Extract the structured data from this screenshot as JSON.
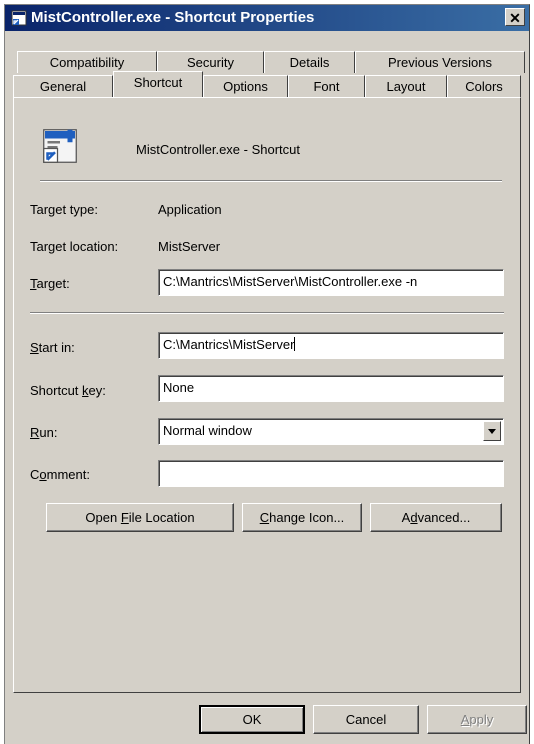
{
  "window": {
    "title": "MistController.exe - Shortcut Properties",
    "close_glyph": "✕"
  },
  "tabs_row_back": [
    "Compatibility",
    "Security",
    "Details",
    "Previous Versions"
  ],
  "tabs_row_front": [
    "General",
    "Shortcut",
    "Options",
    "Font",
    "Layout",
    "Colors"
  ],
  "selected_tab": "Shortcut",
  "shortcut": {
    "name": "MistController.exe - Shortcut",
    "icon": "shortcut-app-icon",
    "target_type_label": "Target type:",
    "target_type_value": "Application",
    "target_location_label": "Target location:",
    "target_location_value": "MistServer",
    "target_label_u": "T",
    "target_label_rest": "arget:",
    "target_value": "C:\\Mantrics\\MistServer\\MistController.exe -n",
    "start_in_label_u": "S",
    "start_in_label_rest": "tart in:",
    "start_in_value": "C:\\Mantrics\\MistServer",
    "shortcut_key_label_pre": "Shortcut ",
    "shortcut_key_label_u": "k",
    "shortcut_key_label_rest": "ey:",
    "shortcut_key_value": "None",
    "run_label_u": "R",
    "run_label_rest": "un:",
    "run_value": "Normal window",
    "comment_label_pre": "C",
    "comment_label_u": "o",
    "comment_label_rest": "mment:",
    "comment_value": ""
  },
  "action_buttons": {
    "open_pre": "Open ",
    "open_u": "F",
    "open_rest": "ile Location",
    "change_u": "C",
    "change_rest": "hange Icon...",
    "adv_pre": "A",
    "adv_u": "d",
    "adv_rest": "vanced..."
  },
  "footer": {
    "ok": "OK",
    "cancel": "Cancel",
    "apply_u": "A",
    "apply_rest": "pply"
  }
}
